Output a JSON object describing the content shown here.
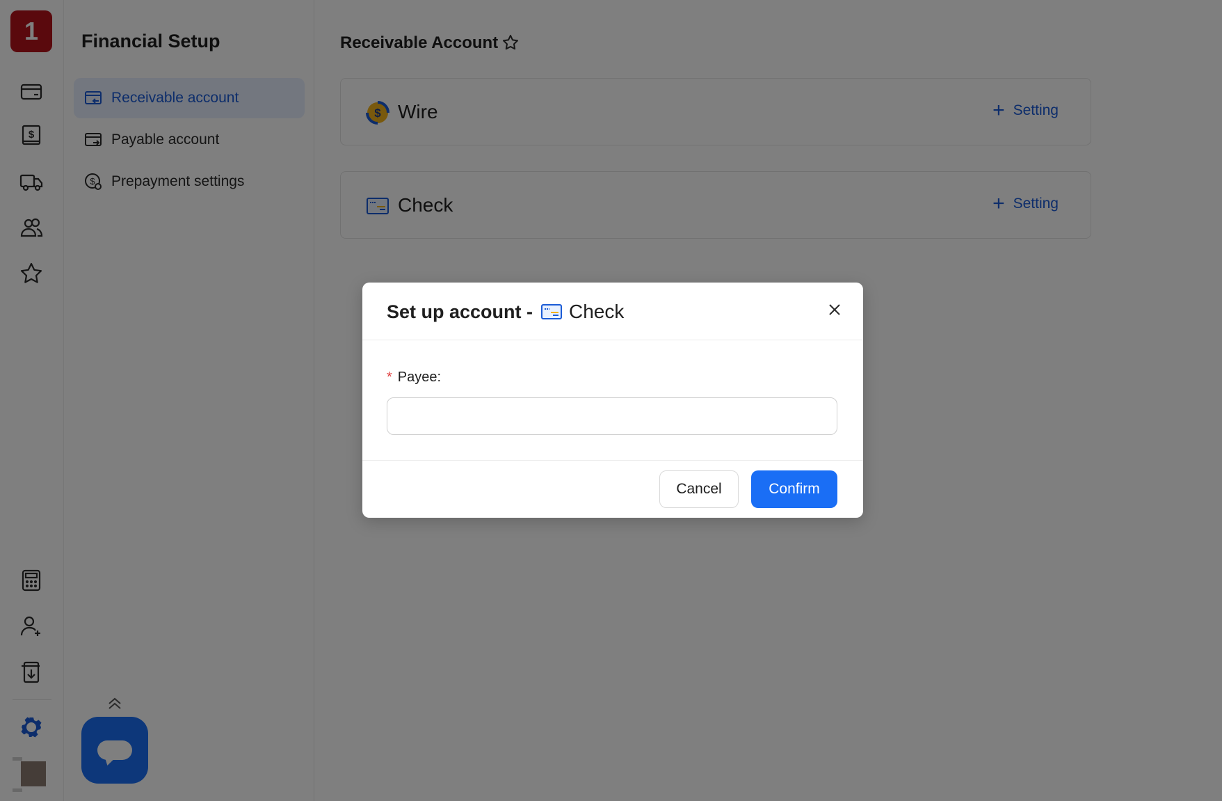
{
  "rail": {
    "logo_text": "1",
    "top_icons": [
      "card-icon",
      "dollar-ledger-icon",
      "truck-icon",
      "users-icon",
      "star-icon"
    ],
    "bottom_icons": [
      "calculator-icon",
      "add-user-icon",
      "download-doc-icon",
      "gear-icon"
    ]
  },
  "sidebar": {
    "title": "Financial Setup",
    "items": [
      {
        "label": "Receivable account",
        "active": true
      },
      {
        "label": "Payable account",
        "active": false
      },
      {
        "label": "Prepayment settings",
        "active": false
      }
    ]
  },
  "main": {
    "title": "Receivable Account",
    "cards": [
      {
        "name": "Wire",
        "action": "Setting"
      },
      {
        "name": "Check",
        "action": "Setting"
      }
    ]
  },
  "modal": {
    "title_prefix": "Set up account -",
    "title_method": "Check",
    "field_label": "Payee:",
    "field_required_mark": "*",
    "payee_value": "",
    "cancel_label": "Cancel",
    "confirm_label": "Confirm"
  },
  "colors": {
    "accent": "#1a6ef5",
    "brand": "#b5121b",
    "link": "#1a5bd6",
    "required": "#e04040"
  }
}
